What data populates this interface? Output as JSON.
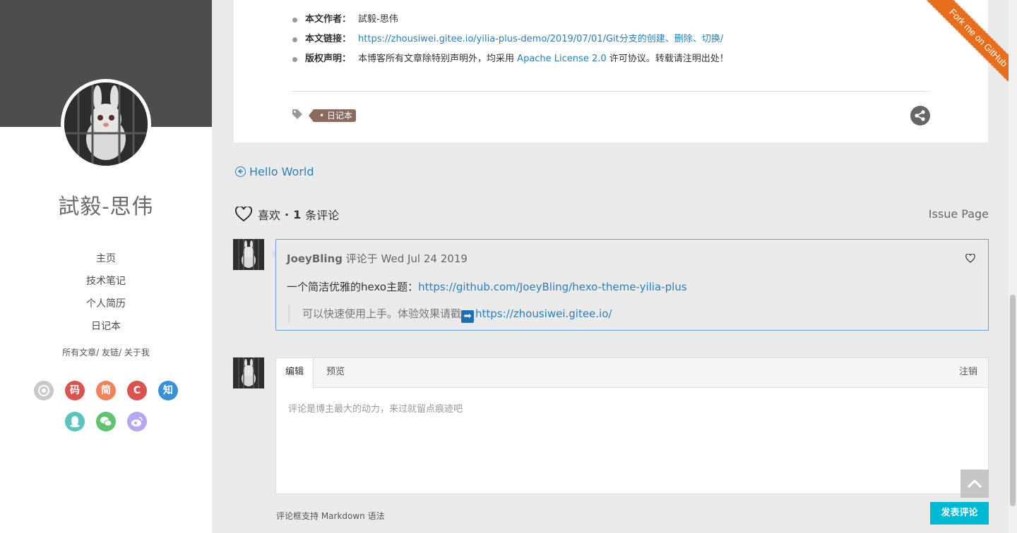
{
  "author": {
    "name": "試毅-思伟"
  },
  "nav": {
    "items": [
      "主页",
      "技术笔记",
      "个人简历",
      "日记本"
    ],
    "sub_items": [
      "所有文章",
      "友链",
      "关于我"
    ],
    "separator": "/"
  },
  "socials": [
    {
      "name": "github-icon",
      "glyph": "",
      "color": "#c9c9c9"
    },
    {
      "name": "gitee-icon",
      "glyph": "码",
      "color": "#d9534f"
    },
    {
      "name": "jianshu-icon",
      "glyph": "简",
      "color": "#f0835b"
    },
    {
      "name": "csdn-icon",
      "glyph": "C",
      "color": "#d9534f"
    },
    {
      "name": "zhihu-icon",
      "glyph": "知",
      "color": "#3a8fd6"
    },
    {
      "name": "qq-icon",
      "glyph": "",
      "color": "#5bc4bf"
    },
    {
      "name": "wechat-icon",
      "glyph": "",
      "color": "#62c26e"
    },
    {
      "name": "weibo-icon",
      "glyph": "",
      "color": "#b7a6f0"
    }
  ],
  "copyright": {
    "author_label": "本文作者：",
    "author_value": "試毅-思伟",
    "link_label": "本文链接：",
    "link_value": "https://zhousiwei.gitee.io/yilia-plus-demo/2019/07/01/Git分支的创建、删除、切换/",
    "license_label": "版权声明：",
    "license_pre": "本博客所有文章除特别声明外，均采用",
    "license_link": "Apache License 2.0",
    "license_post": "许可协议。转载请注明出处！"
  },
  "tags": [
    "日记本"
  ],
  "ribbon": {
    "text": "Fork me on GitHub",
    "color": "#e66e1d"
  },
  "prev_post": {
    "title": "Hello World"
  },
  "comments_header": {
    "like_label": "喜欢",
    "dot": "·",
    "count": "1",
    "count_label": "条评论",
    "issue_page": "Issue Page"
  },
  "comment": {
    "login": "JoeyBling",
    "meta": "评论于 Wed Jul 24 2019",
    "body_text": "一个简洁优雅的hexo主题：",
    "body_link": "https://github.com/JoeyBling/hexo-theme-yilia-plus",
    "quote_text": "可以快速使用上手。体验效果请戳",
    "quote_emoji": "➡",
    "quote_link": "https://zhousiwei.gitee.io/"
  },
  "editor": {
    "tab_edit": "编辑",
    "tab_preview": "预览",
    "logout": "注销",
    "placeholder": "评论是博主最大的动力，来过就留点痕迹吧",
    "markdown_tip": "评论框支持 Markdown 语法",
    "submit": "发表评论"
  },
  "colors": {
    "accent": "#2a7fba",
    "submit": "#00b8d4",
    "tag": "#8b6b5f"
  }
}
